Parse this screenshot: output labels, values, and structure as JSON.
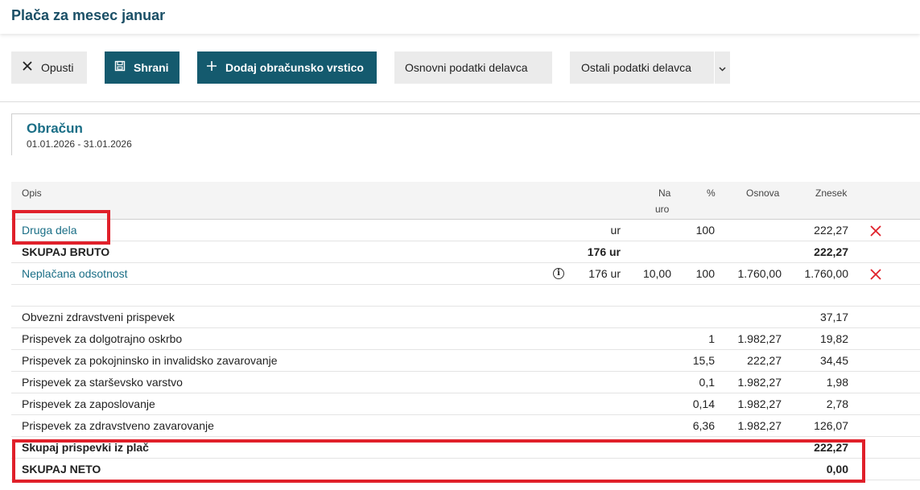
{
  "header": {
    "title": "Plača za mesec januar"
  },
  "toolbar": {
    "cancel_label": "Opusti",
    "save_label": "Shrani",
    "add_label": "Dodaj obračunsko vrstico",
    "basic_label": "Osnovni podatki delavca",
    "other_label": "Ostali podatki delavca"
  },
  "card": {
    "title": "Obračun",
    "period": "01.01.2026 - 31.01.2026"
  },
  "columns": {
    "opis": "Opis",
    "na": "Na",
    "uro": "uro",
    "pct": "%",
    "osnova": "Osnova",
    "znesek": "Znesek"
  },
  "rows": {
    "druga_dela": {
      "opis": "Druga dela",
      "ure": "ur",
      "pct": "100",
      "znesek": "222,27"
    },
    "skupaj_bruto": {
      "opis": "SKUPAJ BRUTO",
      "ure": "176 ur",
      "znesek": "222,27"
    },
    "neplacana": {
      "opis": "Neplačana odsotnost",
      "ure": "176 ur",
      "na_uro": "10,00",
      "pct": "100",
      "osnova": "1.760,00",
      "znesek": "1.760,00"
    }
  },
  "contributions": [
    {
      "opis": "Obvezni zdravstveni prispevek",
      "pct": "",
      "osnova": "",
      "znesek": "37,17"
    },
    {
      "opis": "Prispevek za dolgotrajno oskrbo",
      "pct": "1",
      "osnova": "1.982,27",
      "znesek": "19,82"
    },
    {
      "opis": "Prispevek za pokojninsko in invalidsko zavarovanje",
      "pct": "15,5",
      "osnova": "222,27",
      "znesek": "34,45"
    },
    {
      "opis": "Prispevek za starševsko varstvo",
      "pct": "0,1",
      "osnova": "1.982,27",
      "znesek": "1,98"
    },
    {
      "opis": "Prispevek za zaposlovanje",
      "pct": "0,14",
      "osnova": "1.982,27",
      "znesek": "2,78"
    },
    {
      "opis": "Prispevek za zdravstveno zavarovanje",
      "pct": "6,36",
      "osnova": "1.982,27",
      "znesek": "126,07"
    }
  ],
  "totals": {
    "prispevki": {
      "opis": "Skupaj prispevki iz plač",
      "znesek": "222,27"
    },
    "neto": {
      "opis": "SKUPAJ NETO",
      "znesek": "0,00"
    }
  },
  "colors": {
    "accent": "#145a6e",
    "link": "#1a6e86",
    "highlight": "#e0202a",
    "delete": "#e0202a"
  }
}
